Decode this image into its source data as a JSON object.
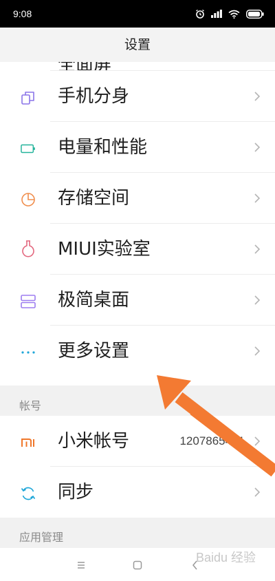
{
  "status": {
    "time": "9:08"
  },
  "title": "设置",
  "top_item_partial": "全面屏",
  "items": [
    {
      "label": "手机分身",
      "icon": "clone-icon",
      "color": "#8a74e8"
    },
    {
      "label": "电量和性能",
      "icon": "battery-icon",
      "color": "#22b39a"
    },
    {
      "label": "存储空间",
      "icon": "storage-pie-icon",
      "color": "#f08e4d"
    },
    {
      "label": "MIUI实验室",
      "icon": "flask-icon",
      "color": "#e3677e"
    },
    {
      "label": "极简桌面",
      "icon": "simple-desktop-icon",
      "color": "#9d7df0"
    },
    {
      "label": "更多设置",
      "icon": "more-dots-icon",
      "color": "#1ea6d8"
    }
  ],
  "section_account": "帐号",
  "account_items": [
    {
      "label": "小米帐号",
      "value": "1207865481",
      "icon": "mi-logo-icon",
      "color": "#f0772a"
    },
    {
      "label": "同步",
      "icon": "sync-icon",
      "color": "#1ea6d8"
    }
  ],
  "section_apps": "应用管理",
  "watermark": "Baidu 经验"
}
